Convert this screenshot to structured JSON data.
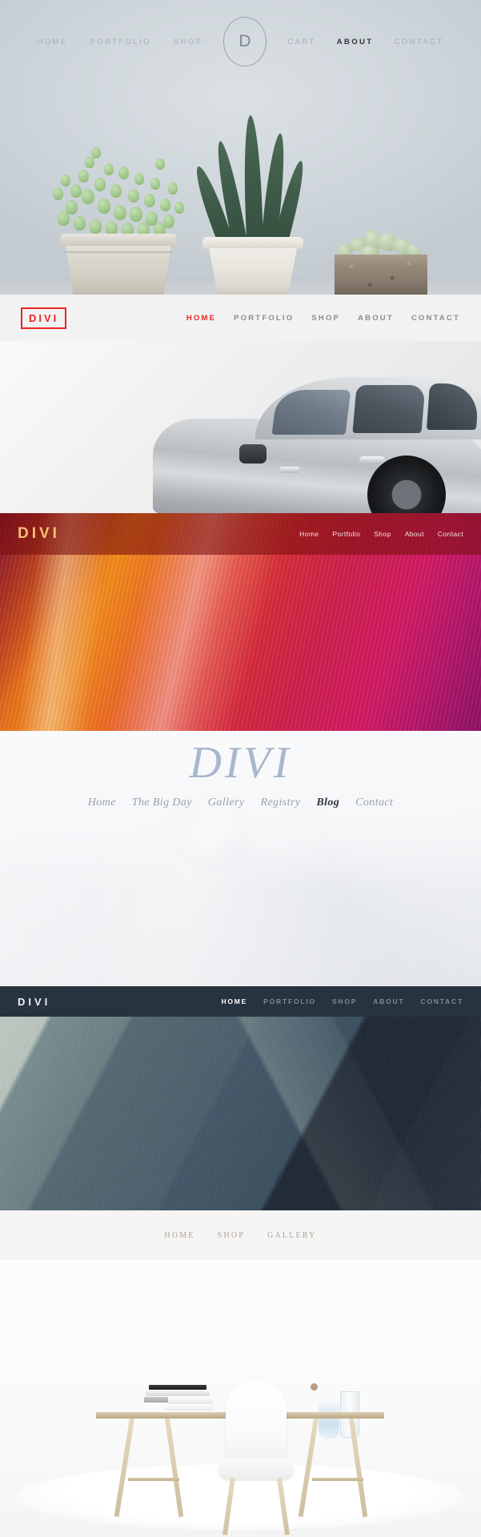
{
  "sections": [
    {
      "id": "succulents-header",
      "logo": {
        "type": "circle",
        "text": "D"
      },
      "nav_left": [
        {
          "label": "HOME",
          "active": false
        },
        {
          "label": "PORTFOLIO",
          "active": false
        },
        {
          "label": "SHOP",
          "active": false
        }
      ],
      "nav_right": [
        {
          "label": "CART",
          "active": false
        },
        {
          "label": "ABOUT",
          "active": true
        },
        {
          "label": "CONTACT",
          "active": false
        }
      ],
      "colors": {
        "bar": "#d3d9dd",
        "link": "#a6aeb4",
        "active": "#2d3338"
      }
    },
    {
      "id": "car-header",
      "logo": {
        "text": "DIVI",
        "style": "boxed-red",
        "color": "#ee2222"
      },
      "nav": [
        {
          "label": "HOME",
          "active": true
        },
        {
          "label": "PORTFOLIO",
          "active": false
        },
        {
          "label": "SHOP",
          "active": false
        },
        {
          "label": "ABOUT",
          "active": false
        },
        {
          "label": "CONTACT",
          "active": false
        }
      ],
      "colors": {
        "bar": "#f2f2f2",
        "link": "#8d8d8d",
        "active": "#ee2222"
      }
    },
    {
      "id": "canyon-header",
      "logo": {
        "text": "DIVI",
        "color": "#f6c173"
      },
      "nav": [
        {
          "label": "Home",
          "active": false
        },
        {
          "label": "Portfolio",
          "active": false
        },
        {
          "label": "Shop",
          "active": false
        },
        {
          "label": "About",
          "active": false
        },
        {
          "label": "Contact",
          "active": false
        }
      ],
      "colors": {
        "bar": "rgba(120,14,14,0.58)",
        "link": "#f2e3e3"
      }
    },
    {
      "id": "wedding-header",
      "logo": {
        "text": "DIVI",
        "style": "serif-italic",
        "color": "#a8b8cc"
      },
      "nav": [
        {
          "label": "Home",
          "active": false
        },
        {
          "label": "The Big Day",
          "active": false
        },
        {
          "label": "Gallery",
          "active": false
        },
        {
          "label": "Registry",
          "active": false
        },
        {
          "label": "Blog",
          "active": true
        },
        {
          "label": "Contact",
          "active": false
        }
      ],
      "colors": {
        "link": "#9aa0a8",
        "active": "#2f3640"
      }
    },
    {
      "id": "concrete-header",
      "logo": {
        "text": "DIVI",
        "color": "#eef1f3"
      },
      "nav": [
        {
          "label": "HOME",
          "active": true
        },
        {
          "label": "PORTFOLIO",
          "active": false
        },
        {
          "label": "SHOP",
          "active": false
        },
        {
          "label": "ABOUT",
          "active": false
        },
        {
          "label": "CONTACT",
          "active": false
        }
      ],
      "colors": {
        "bar": "#27333f",
        "link": "#7d8c99",
        "active": "#ffffff"
      }
    },
    {
      "id": "desk-header",
      "nav": [
        {
          "label": "HOME",
          "active": false
        },
        {
          "label": "SHOP",
          "active": false
        },
        {
          "label": "GALLERY",
          "active": false
        }
      ],
      "colors": {
        "bar": "#f5f5f5",
        "link": "#b2a193"
      }
    }
  ]
}
